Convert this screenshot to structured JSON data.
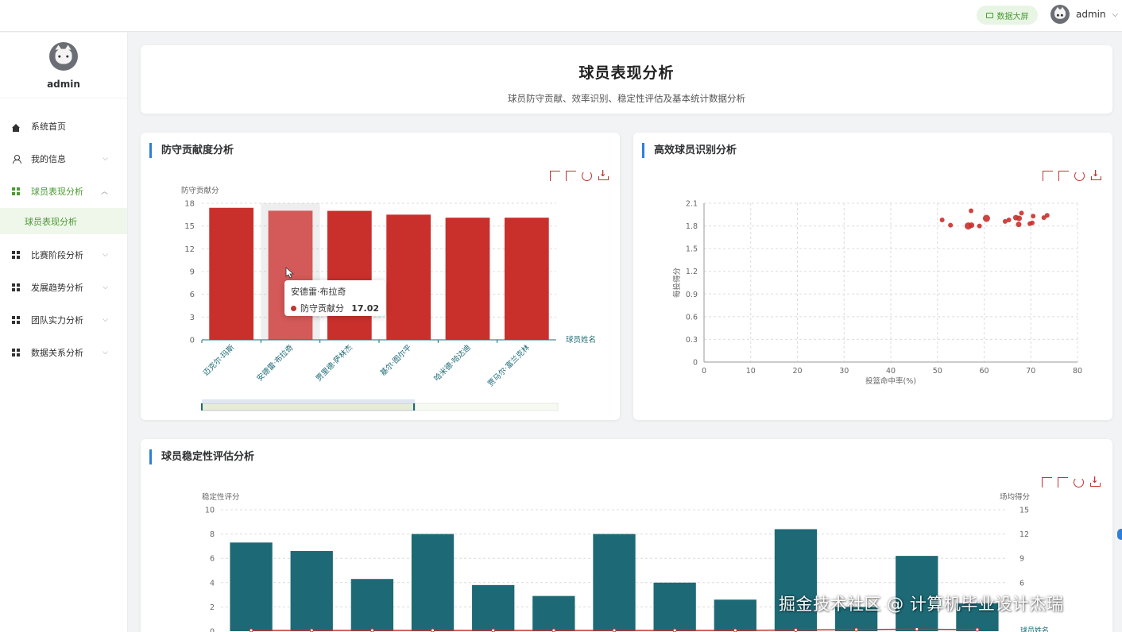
{
  "topbar": {
    "bigscreen_label": "数据大屏",
    "username": "admin",
    "colors": {
      "accent": "#4a9a32",
      "accent_bg": "#e8f5e4"
    }
  },
  "sidebar": {
    "username": "admin",
    "items": [
      {
        "label": "系统首页",
        "icon": "home-icon"
      },
      {
        "label": "我的信息",
        "icon": "user-icon"
      },
      {
        "label": "球员表现分析",
        "icon": "grid-icon",
        "active": true
      },
      {
        "label": "比赛阶段分析",
        "icon": "grid-icon"
      },
      {
        "label": "发展趋势分析",
        "icon": "grid-icon"
      },
      {
        "label": "团队实力分析",
        "icon": "grid-icon"
      },
      {
        "label": "数据关系分析",
        "icon": "grid-icon"
      }
    ],
    "submenu": {
      "label": "球员表现分析"
    }
  },
  "header": {
    "title": "球员表现分析",
    "subtitle": "球员防守贡献、效率识别、稳定性评估及基本统计数据分析"
  },
  "cards": {
    "defense": {
      "title": "防守贡献度分析"
    },
    "efficiency": {
      "title": "高效球员识别分析"
    },
    "stability": {
      "title": "球员稳定性评估分析"
    }
  },
  "tooltip": {
    "name": "安德雷·布拉奇",
    "series": "防守贡献分",
    "value": "17.02"
  },
  "chart_data": [
    {
      "type": "bar",
      "ylabel": "防守贡献分",
      "xlabel": "球员姓名",
      "ylim": [
        0,
        18
      ],
      "yticks": [
        0,
        3,
        6,
        9,
        12,
        15,
        18
      ],
      "categories": [
        "迈克尔·玛斯",
        "安德雷·布拉奇",
        "贾里德·萨林杰",
        "基尔·图尔平",
        "哈米德·哈达迪",
        "贾马尔·富兰克林"
      ],
      "values": [
        17.4,
        17.02,
        17.0,
        16.5,
        16.1,
        16.1
      ],
      "highlighted_index": 1,
      "color": "#c9302c",
      "grid": true
    },
    {
      "type": "scatter",
      "xlabel": "投篮命中率(%)",
      "ylabel": "每投得分",
      "xlim": [
        0,
        80
      ],
      "ylim": [
        0,
        2.1
      ],
      "xticks": [
        0,
        10,
        20,
        30,
        40,
        50,
        60,
        70,
        80
      ],
      "yticks": [
        0,
        0.3,
        0.6,
        0.9,
        1.2,
        1.5,
        1.8,
        2.1
      ],
      "points": [
        {
          "x": 51,
          "y": 1.88,
          "r": 3
        },
        {
          "x": 52.8,
          "y": 1.81,
          "r": 3
        },
        {
          "x": 56.6,
          "y": 1.8,
          "r": 4.5
        },
        {
          "x": 57.3,
          "y": 1.81,
          "r": 3.5
        },
        {
          "x": 57.2,
          "y": 2.0,
          "r": 3
        },
        {
          "x": 59,
          "y": 1.8,
          "r": 3
        },
        {
          "x": 60.5,
          "y": 1.9,
          "r": 4.5
        },
        {
          "x": 64.5,
          "y": 1.86,
          "r": 3
        },
        {
          "x": 65.3,
          "y": 1.88,
          "r": 3
        },
        {
          "x": 66.8,
          "y": 1.91,
          "r": 3.5
        },
        {
          "x": 67.5,
          "y": 1.9,
          "r": 3.5
        },
        {
          "x": 67.4,
          "y": 1.82,
          "r": 3.5
        },
        {
          "x": 68,
          "y": 1.97,
          "r": 3
        },
        {
          "x": 69.8,
          "y": 1.83,
          "r": 3
        },
        {
          "x": 70.3,
          "y": 1.84,
          "r": 3
        },
        {
          "x": 70.5,
          "y": 1.93,
          "r": 3
        },
        {
          "x": 72.8,
          "y": 1.91,
          "r": 3
        },
        {
          "x": 73.5,
          "y": 1.94,
          "r": 3
        }
      ],
      "color": "#c9302c",
      "grid": true
    },
    {
      "type": "bar",
      "ylabel": "稳定性评分",
      "ylabel_right": "场均得分",
      "xlabel": "球员姓名",
      "ylim": [
        0,
        10
      ],
      "ylim_right": [
        0,
        15
      ],
      "yticks": [
        0,
        2,
        4,
        6,
        8,
        10
      ],
      "yticks_right": [
        6,
        9,
        12,
        15
      ],
      "values": [
        7.3,
        6.6,
        4.3,
        8.0,
        3.8,
        2.9,
        8.0,
        4.0,
        2.6,
        8.4,
        2.0,
        6.2,
        2.3
      ],
      "line_values": [
        0,
        0,
        0,
        0,
        0,
        0,
        0,
        0,
        0,
        0.05,
        0.1,
        0.15,
        0.1
      ],
      "color": "#1d6a76",
      "line_color": "#c23531",
      "grid": true
    }
  ],
  "watermark": "掘金技术社区 @ 计算机毕业设计杰瑞"
}
